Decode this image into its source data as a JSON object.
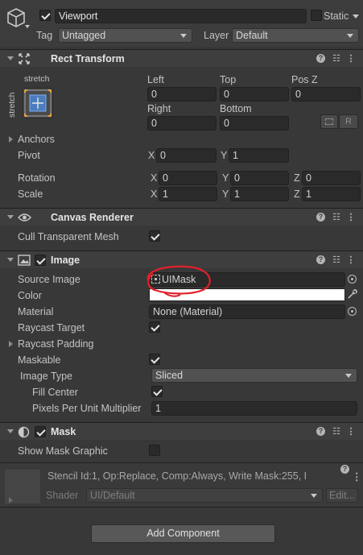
{
  "gameobject": {
    "name": "Viewport",
    "static_label": "Static",
    "tag_label": "Tag",
    "tag_value": "Untagged",
    "layer_label": "Layer",
    "layer_value": "Default",
    "active": true
  },
  "rect_transform": {
    "title": "Rect Transform",
    "stretch_top": "stretch",
    "stretch_side": "stretch",
    "left_label": "Left",
    "left_value": "0",
    "top_label": "Top",
    "top_value": "0",
    "posz_label": "Pos Z",
    "posz_value": "0",
    "right_label": "Right",
    "right_value": "0",
    "bottom_label": "Bottom",
    "bottom_value": "0",
    "r_button": "R",
    "anchors_label": "Anchors",
    "pivot_label": "Pivot",
    "pivot_x": "0",
    "pivot_y": "1",
    "rotation_label": "Rotation",
    "rot_x": "0",
    "rot_y": "0",
    "rot_z": "0",
    "scale_label": "Scale",
    "scale_x": "1",
    "scale_y": "1",
    "scale_z": "1",
    "x": "X",
    "y": "Y",
    "z": "Z"
  },
  "canvas_renderer": {
    "title": "Canvas Renderer",
    "cull_label": "Cull Transparent Mesh",
    "cull_checked": true
  },
  "image": {
    "title": "Image",
    "enabled": true,
    "source_label": "Source Image",
    "source_value": "UIMask",
    "color_label": "Color",
    "color_value": "#ffffff",
    "material_label": "Material",
    "material_value": "None (Material)",
    "raycast_label": "Raycast Target",
    "raycast_checked": true,
    "padding_label": "Raycast Padding",
    "maskable_label": "Maskable",
    "maskable_checked": true,
    "type_label": "Image Type",
    "type_value": "Sliced",
    "fill_label": "Fill Center",
    "fill_checked": true,
    "ppu_label": "Pixels Per Unit Multiplier",
    "ppu_value": "1"
  },
  "mask": {
    "title": "Mask",
    "enabled": true,
    "show_label": "Show Mask Graphic",
    "show_checked": false
  },
  "material_preview": {
    "info": "Stencil Id:1, Op:Replace, Comp:Always, Write Mask:255, I",
    "shader_label": "Shader",
    "shader_value": "UI/Default",
    "edit_button": "Edit..."
  },
  "add_component": "Add Component",
  "colors": {
    "annotation": "#e0202a",
    "panel": "#383838",
    "header": "#3e3e3e"
  }
}
